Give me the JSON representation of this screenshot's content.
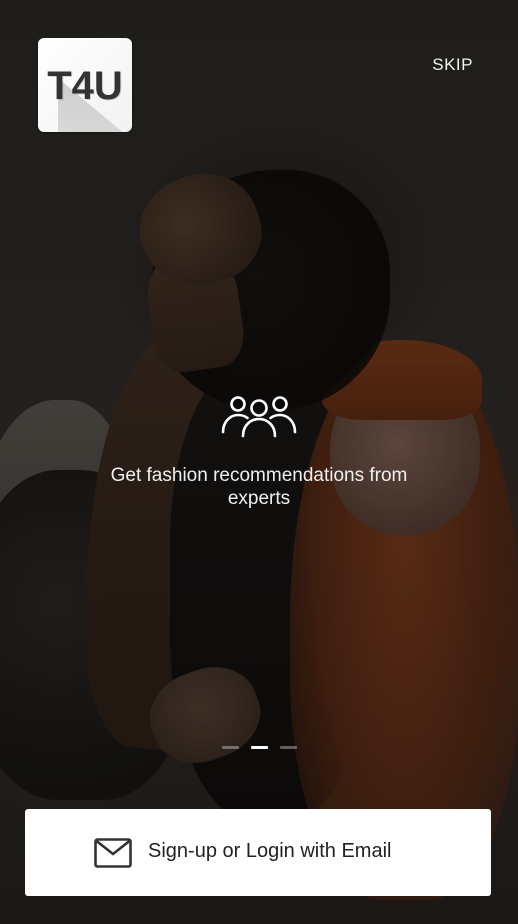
{
  "logo": {
    "text": "T4U",
    "icon": "t4u-logo"
  },
  "header": {
    "skip_label": "SKIP"
  },
  "feature": {
    "icon": "group-people-icon",
    "caption": "Get fashion recommendations from experts"
  },
  "pager": {
    "total": 3,
    "active_index": 1
  },
  "login": {
    "icon": "mail-icon",
    "label": "Sign-up or Login with Email"
  },
  "colors": {
    "overlay": "#23211f",
    "button_bg": "#ffffff",
    "text_light": "#ffffff",
    "text_dark": "#222222"
  }
}
